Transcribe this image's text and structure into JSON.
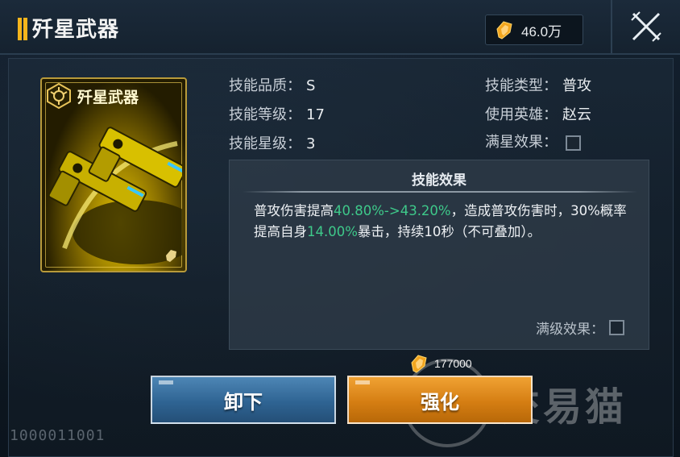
{
  "window": {
    "title": "歼星武器",
    "currency_value": "46.0万"
  },
  "card": {
    "name": "歼星武器"
  },
  "info": {
    "quality_label": "技能品质：",
    "quality_value": "S",
    "level_label": "技能等级：",
    "level_value": "17",
    "star_label": "技能星级：",
    "star_value": "3",
    "type_label": "技能类型：",
    "type_value": "普攻",
    "hero_label": "使用英雄：",
    "hero_value": "赵云",
    "fullstar_label": "满星效果："
  },
  "effect": {
    "title": "技能效果",
    "text_1": "普攻伤害提高",
    "highlight_1": "40.80%->43.20%",
    "text_2": "，造成普攻伤害时，30%概率提高自身",
    "highlight_2": "14.00%",
    "text_3": "暴击，持续10秒（不可叠加）。",
    "full_level_label": "满级效果："
  },
  "cost": {
    "amount": "177000"
  },
  "buttons": {
    "unequip": "卸下",
    "enhance": "强化"
  },
  "watermark": {
    "text": "交易猫",
    "id": "1000011001"
  },
  "colors": {
    "accent_gold": "#f5b51c",
    "highlight_green": "#3ec98a",
    "button_blue": "#2f6493",
    "button_orange": "#d57e13"
  }
}
